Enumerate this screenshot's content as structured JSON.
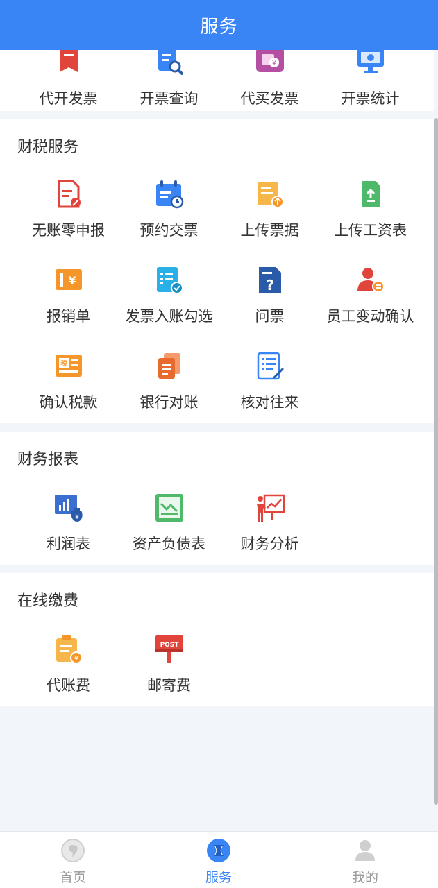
{
  "header": {
    "title": "服务"
  },
  "top_items": [
    {
      "label": "代开发票",
      "icon": "invoice-issue-icon"
    },
    {
      "label": "开票查询",
      "icon": "invoice-search-icon"
    },
    {
      "label": "代买发票",
      "icon": "invoice-buy-icon"
    },
    {
      "label": "开票统计",
      "icon": "invoice-stats-icon"
    }
  ],
  "sections": [
    {
      "title": "财税服务",
      "items": [
        {
          "label": "无账零申报",
          "icon": "zero-declare-icon"
        },
        {
          "label": "预约交票",
          "icon": "calendar-icon"
        },
        {
          "label": "上传票据",
          "icon": "upload-receipt-icon"
        },
        {
          "label": "上传工资表",
          "icon": "upload-payroll-icon"
        },
        {
          "label": "报销单",
          "icon": "reimburse-icon"
        },
        {
          "label": "发票入账勾选",
          "icon": "invoice-check-icon"
        },
        {
          "label": "问票",
          "icon": "question-doc-icon"
        },
        {
          "label": "员工变动确认",
          "icon": "employee-change-icon"
        },
        {
          "label": "确认税款",
          "icon": "tax-confirm-icon"
        },
        {
          "label": "银行对账",
          "icon": "bank-reconcile-icon"
        },
        {
          "label": "核对往来",
          "icon": "checklist-edit-icon"
        }
      ]
    },
    {
      "title": "财务报表",
      "items": [
        {
          "label": "利润表",
          "icon": "profit-chart-icon"
        },
        {
          "label": "资产负债表",
          "icon": "balance-sheet-icon"
        },
        {
          "label": "财务分析",
          "icon": "presentation-chart-icon"
        }
      ]
    },
    {
      "title": "在线缴费",
      "items": [
        {
          "label": "代账费",
          "icon": "bookkeeping-fee-icon"
        },
        {
          "label": "邮寄费",
          "icon": "post-box-icon"
        }
      ]
    }
  ],
  "tabbar": {
    "items": [
      {
        "label": "首页",
        "icon": "home-icon",
        "active": false
      },
      {
        "label": "服务",
        "icon": "service-icon",
        "active": true
      },
      {
        "label": "我的",
        "icon": "user-icon",
        "active": false
      }
    ]
  },
  "colors": {
    "brand_blue": "#3a85f5",
    "red": "#e0443a",
    "orange": "#f5962a",
    "yellow": "#f7b64a",
    "green": "#4fb96a",
    "navy": "#2a5ba8",
    "purple": "#b44fa2",
    "inactive_gray": "#999999"
  }
}
